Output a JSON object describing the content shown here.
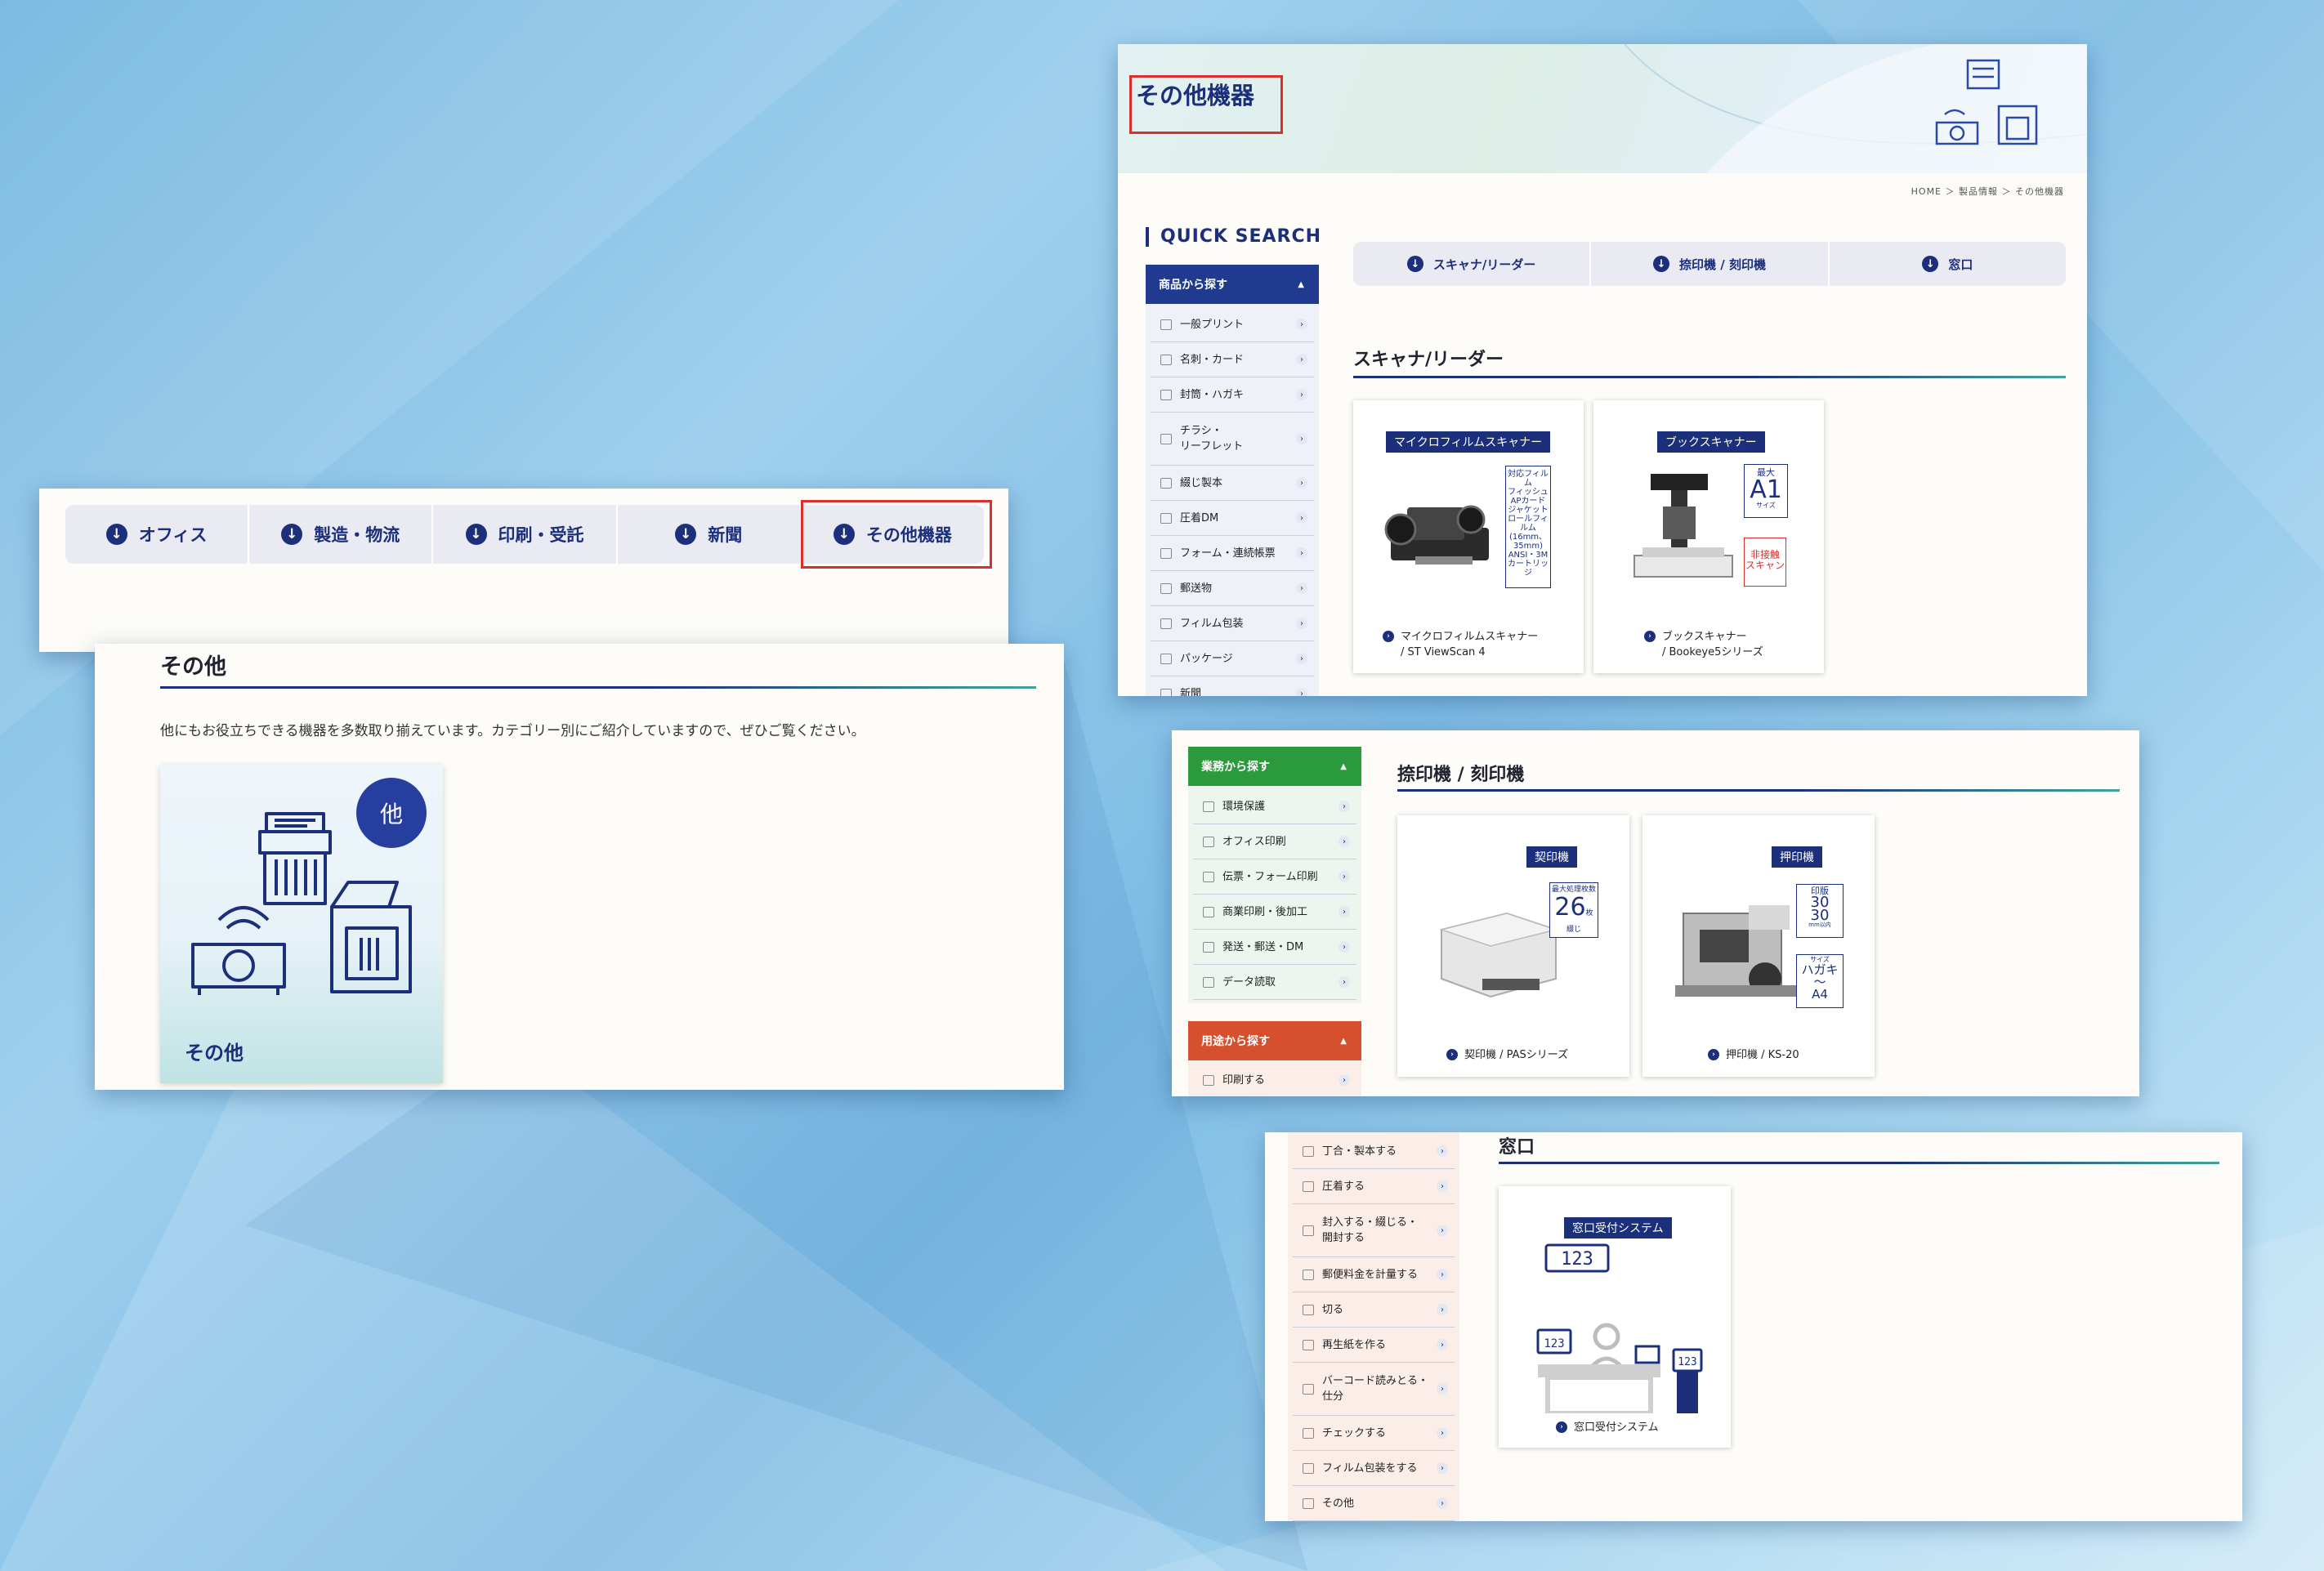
{
  "nav": {
    "tabs": [
      {
        "label": "オフィス"
      },
      {
        "label": "製造・物流"
      },
      {
        "label": "印刷・受託"
      },
      {
        "label": "新聞"
      },
      {
        "label": "その他機器"
      }
    ],
    "highlighted_tab": "その他機器"
  },
  "other_section": {
    "title": "その他",
    "description": "他にもお役立ちできる機器を多数取り揃えています。カテゴリー別にご紹介していますので、ぜひご覧ください。",
    "card_label": "その他",
    "card_badge": "他"
  },
  "main_page": {
    "hero_title": "その他機器",
    "breadcrumb": "HOME ＞ 製品情報 ＞ その他機器",
    "quick_search": "QUICK SEARCH",
    "sidebar_products": {
      "heading": "商品から探す",
      "items": [
        "一般プリント",
        "名刺・カード",
        "封筒・ハガキ",
        "チラシ・\nリーフレット",
        "綴じ製本",
        "圧着DM",
        "フォーム・連続帳票",
        "郵送物",
        "フィルム包装",
        "パッケージ",
        "新聞"
      ]
    },
    "sub_tabs": [
      "スキャナ/リーダー",
      "捺印機 / 刻印機",
      "窓口"
    ],
    "scanner_section": {
      "title": "スキャナ/リーダー",
      "products": [
        {
          "tag": "マイクロフィルムスキャナー",
          "caption": "マイクロフィルムスキャナー\n/ ST ViewScan 4",
          "spec": "対応フィルム\nフィッシュ\nAPカード\nジャケット\nロールフィルム\n(16mm、35mm)\nANSI・3M\nカートリッジ"
        },
        {
          "tag": "ブックスキャナー",
          "caption": "ブックスキャナー\n/ Bookeye5シリーズ",
          "spec_top": "最大",
          "spec_main": "A1",
          "spec_sub": "サイズ",
          "spec_red": "非接触\nスキャン"
        }
      ]
    }
  },
  "seal_panel": {
    "sidebar_business": {
      "heading": "業務から探す",
      "items": [
        "環境保護",
        "オフィス印刷",
        "伝票・フォーム印刷",
        "商業印刷・後加工",
        "発送・郵送・DM",
        "データ読取"
      ]
    },
    "sidebar_use": {
      "heading": "用途から探す",
      "items": [
        "印刷する"
      ]
    },
    "title": "捺印機 / 刻印機",
    "products": [
      {
        "tag": "契印機",
        "caption": "契印機 / PASシリーズ",
        "spec_top": "最大処理枚数",
        "spec_main": "26",
        "spec_unit": "枚",
        "spec_bottom": "綴じ"
      },
      {
        "tag": "押印機",
        "caption": "押印機 / KS-20",
        "spec1_top": "印版",
        "spec1_main": "30\n30",
        "spec1_unit": "mm以内",
        "spec2_top": "サイズ",
        "spec2_main": "ハガキ\n〜\nA4"
      }
    ]
  },
  "window_panel": {
    "use_items": [
      "丁合・製本する",
      "圧着する",
      "封入する・綴じる・\n開封する",
      "郵便料金を計量する",
      "切る",
      "再生紙を作る",
      "バーコード読みとる・\n仕分",
      "チェックする",
      "フィルム包装をする",
      "その他"
    ],
    "title": "窓口",
    "product": {
      "tag": "窓口受付システム",
      "caption": "窓口受付システム",
      "display": "123"
    }
  },
  "colors": {
    "navy": "#1c2f7b",
    "teal": "#3fa59a",
    "green": "#2a9a3c",
    "orange": "#d6502e",
    "highlight_red": "#d9302c"
  }
}
